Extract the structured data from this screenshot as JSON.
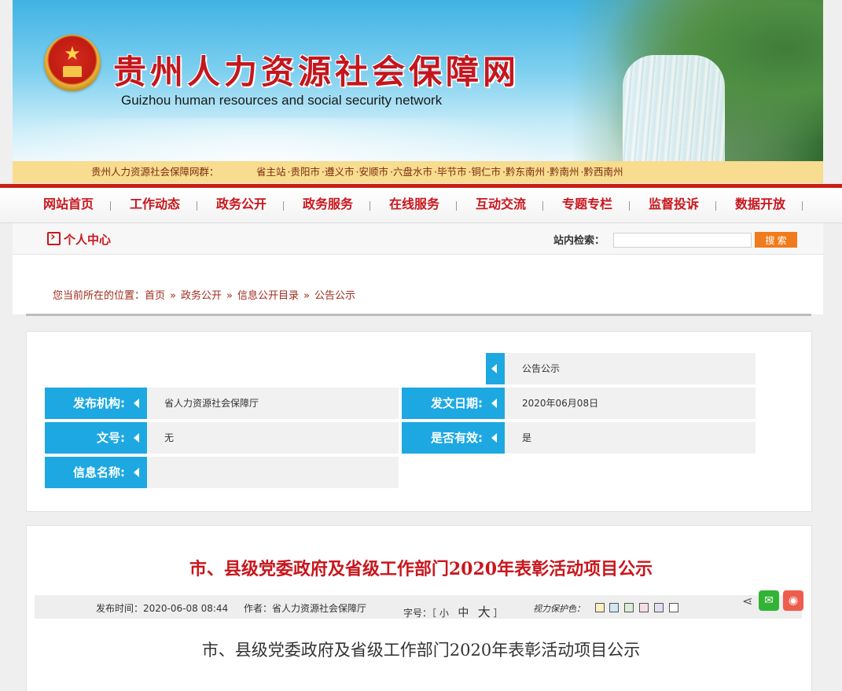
{
  "header": {
    "site_title": "贵州人力资源社会保障网",
    "site_subtitle": "Guizhou human resources and social security network",
    "emblem_icon": "national-emblem-icon"
  },
  "sites_bar": {
    "label": "贵州人力资源社会保障网群：",
    "links": [
      "省主站",
      "贵阳市",
      "遵义市",
      "安顺市",
      "六盘水市",
      "毕节市",
      "铜仁市",
      "黔东南州",
      "黔南州",
      "黔西南州"
    ]
  },
  "nav": {
    "items": [
      "网站首页",
      "工作动态",
      "政务公开",
      "政务服务",
      "在线服务",
      "互动交流",
      "专题专栏",
      "监督投诉",
      "数据开放"
    ]
  },
  "userbar": {
    "personal_center": "个人中心",
    "search_label": "站内检索：",
    "search_value": "",
    "search_button": "搜 索"
  },
  "breadcrumb": {
    "prefix": "您当前所在的位置：",
    "items": [
      "首页",
      "政务公开",
      "信息公开目录",
      "公告公示"
    ],
    "separator": "»"
  },
  "info": {
    "category": "公告公示",
    "publisher_label": "发布机构:",
    "publisher": "省人力资源社会保障厅",
    "date_label": "发文日期:",
    "date": "2020年06月08日",
    "docno_label": "文号:",
    "docno": "无",
    "valid_label": "是否有效:",
    "valid": "是",
    "title_label": "信息名称:",
    "title": ""
  },
  "article": {
    "title": "市、县级党委政府及省级工作部门2020年表彰活动项目公示",
    "publish_time_label": "发布时间：",
    "publish_time": "2020-06-08 08:44",
    "author_label": "作者：",
    "author": "省人力资源社会保障厅",
    "font_size_label": "字号：",
    "font_sizes": [
      "小",
      "中",
      "大"
    ],
    "eye_care_label": "视力保护色：",
    "eye_care_colors": [
      "#fcefc2",
      "#cfe8f2",
      "#d9ecd6",
      "#f9dde6",
      "#e6dcf3",
      "#ffffff"
    ],
    "body_title": "市、县级党委政府及省级工作部门2020年表彰活动项目公示"
  },
  "share": {
    "share_icon": "share-icon",
    "wechat_icon": "wechat-icon",
    "weibo_icon": "weibo-icon"
  },
  "colors": {
    "brand_red": "#c8161d",
    "accent_blue": "#1da8e2",
    "search_orange": "#f07b1c"
  }
}
